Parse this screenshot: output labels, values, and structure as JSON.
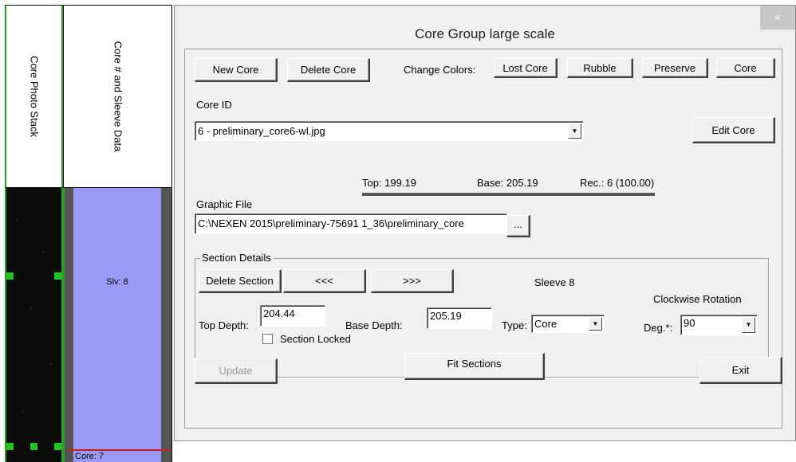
{
  "strip": {
    "col1_header": "Core Photo Stack",
    "col2_header": "Core # and Sleeve Data",
    "sleeve_label": "Slv: 8",
    "core_label": "Core: 7"
  },
  "dialog": {
    "title": "Core Group large scale",
    "close": "×",
    "buttons": {
      "new_core": "New Core",
      "delete_core": "Delete Core",
      "change_colors_label": "Change Colors:",
      "lost_core": "Lost Core",
      "rubble": "Rubble",
      "preserve": "Preserve",
      "core": "Core",
      "edit_core": "Edit Core"
    },
    "core_id": {
      "label": "Core ID",
      "value": "6 - preliminary_core6-wl.jpg"
    },
    "stats": {
      "top": "Top: 199.19",
      "base": "Base: 205.19",
      "rec": "Rec.: 6 (100.00)"
    },
    "graphic_file": {
      "label": "Graphic File",
      "value": "C:\\NEXEN 2015\\preliminary-75691 1_36\\preliminary_core",
      "browse": "..."
    },
    "section": {
      "title": "Section Details",
      "delete": "Delete Section",
      "prev": "<<<",
      "next": ">>>",
      "sleeve": "Sleeve 8",
      "rotation_label": "Clockwise Rotation",
      "top_depth_label": "Top Depth:",
      "top_depth_value": "204.44",
      "base_depth_label": "Base Depth:",
      "base_depth_value": "205.19",
      "type_label": "Type:",
      "type_value": "Core",
      "deg_label": "Deg.*:",
      "deg_value": "90",
      "locked_label": "Section Locked",
      "update": "Update",
      "fit": "Fit Sections",
      "exit": "Exit"
    }
  },
  "colors": {
    "sleeve_fill": "#9b9bf7",
    "marker": "#22c322",
    "dialog_bg": "#f0f0f0"
  }
}
